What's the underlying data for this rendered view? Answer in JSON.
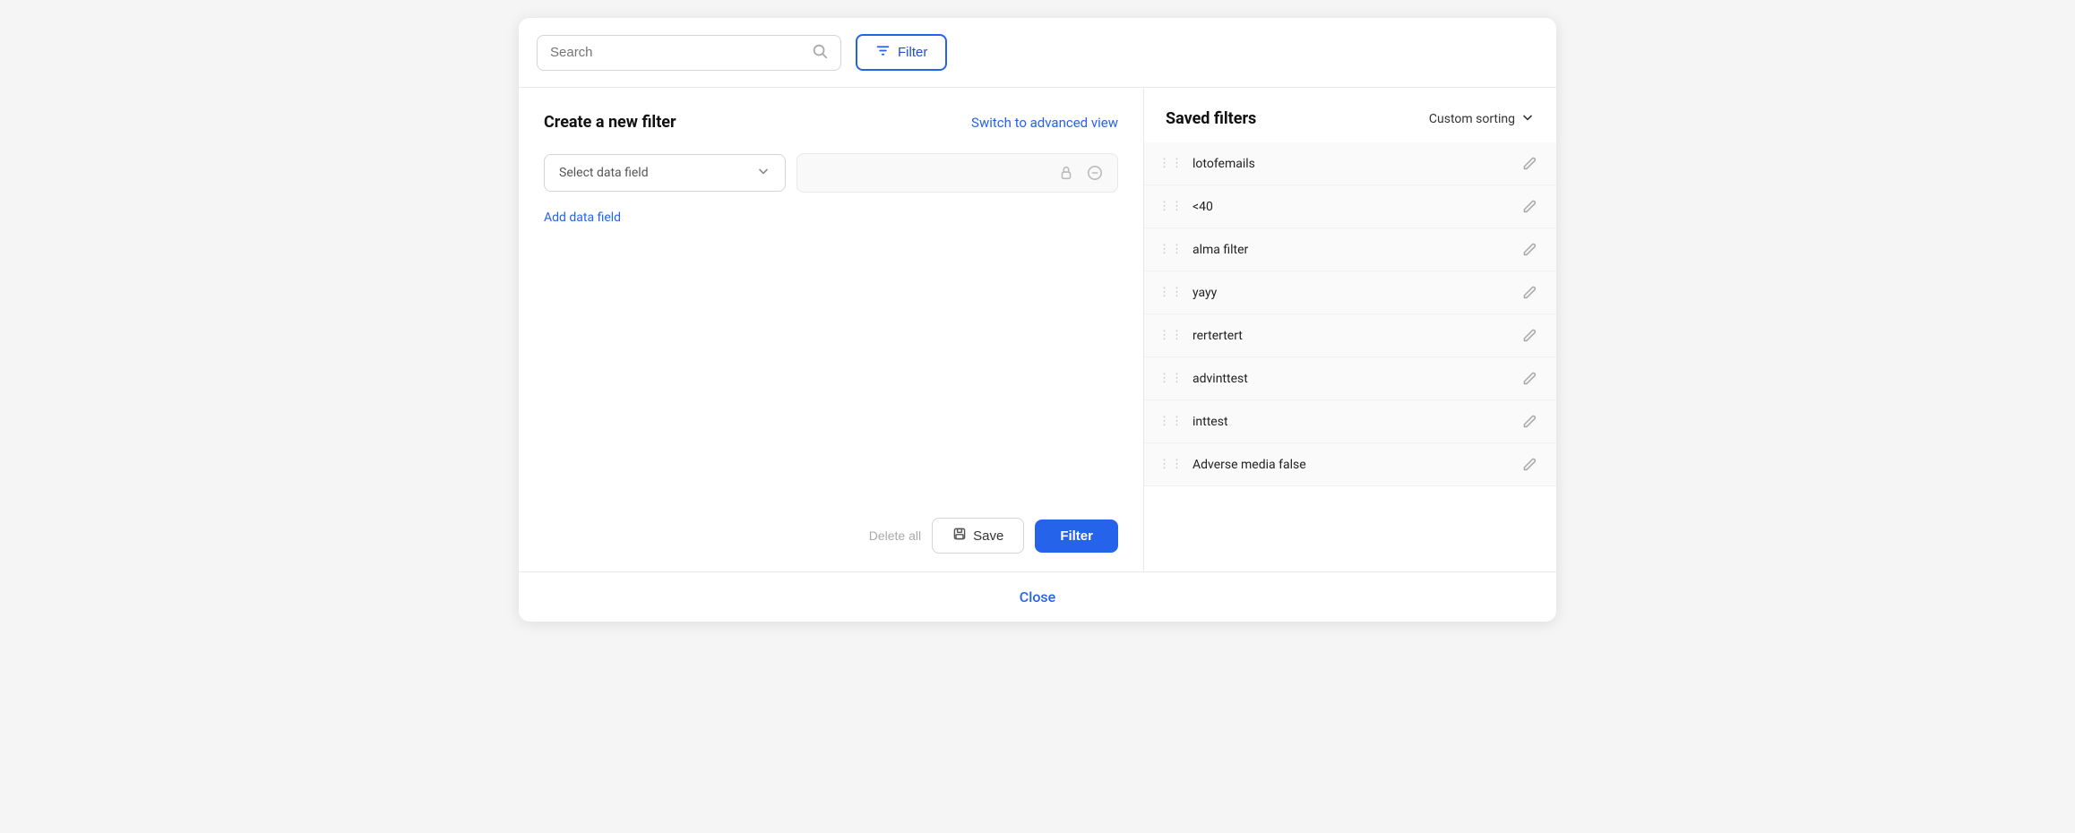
{
  "topbar": {
    "search_placeholder": "Search",
    "filter_button_label": "Filter"
  },
  "left_panel": {
    "title": "Create a new filter",
    "advanced_link": "Switch to advanced view",
    "select_placeholder": "Select data field",
    "add_field_label": "Add data field",
    "delete_all_label": "Delete all",
    "save_label": "Save",
    "filter_label": "Filter"
  },
  "right_panel": {
    "title": "Saved filters",
    "sorting_label": "Custom sorting",
    "filters": [
      {
        "name": "lotofemails"
      },
      {
        "name": "<40"
      },
      {
        "name": "alma filter"
      },
      {
        "name": "yayy"
      },
      {
        "name": "rertertert"
      },
      {
        "name": "advinttest"
      },
      {
        "name": "inttest"
      },
      {
        "name": "Adverse media false"
      }
    ]
  },
  "footer": {
    "close_label": "Close"
  },
  "colors": {
    "accent": "#2563eb"
  }
}
